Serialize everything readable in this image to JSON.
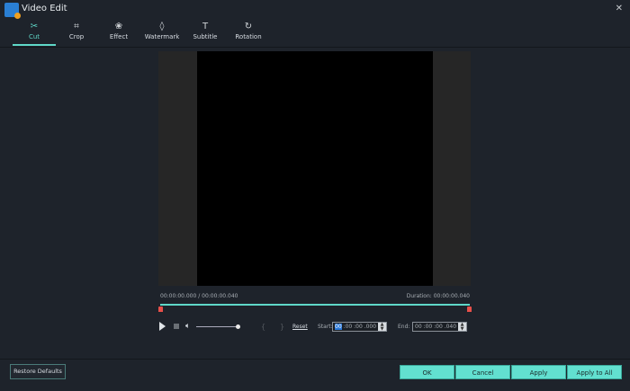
{
  "window": {
    "title": "Video Edit",
    "close": "✕"
  },
  "tabs": [
    {
      "label": "Cut",
      "icon": "✂"
    },
    {
      "label": "Crop",
      "icon": "⌗"
    },
    {
      "label": "Effect",
      "icon": "❀"
    },
    {
      "label": "Watermark",
      "icon": "◊"
    },
    {
      "label": "Subtitle",
      "icon": "T"
    },
    {
      "label": "Rotation",
      "icon": "↻"
    }
  ],
  "active_tab": "Cut",
  "timeline": {
    "current": "00:00:00.000 / 00:00:00.040",
    "duration": "Duration: 00:00:00.040"
  },
  "controls": {
    "mark_in": "{",
    "mark_out": "}",
    "reset": "Reset",
    "start_label": "Start:",
    "start_value": "00 :00 :00 .000",
    "start_selected": "00",
    "end_label": "End:",
    "end_value": "00 :00 :00 .040",
    "volume_level": 1.0
  },
  "footer": {
    "restore": "Restore Defaults",
    "ok": "OK",
    "cancel": "Cancel",
    "apply": "Apply",
    "apply_all": "Apply to All"
  },
  "colors": {
    "accent": "#5fd8c8",
    "handle": "#e8504a"
  }
}
